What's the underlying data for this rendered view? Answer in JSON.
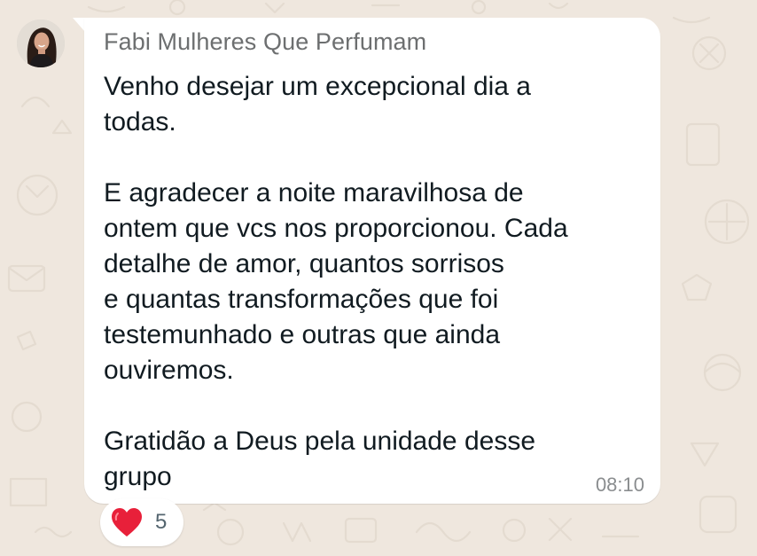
{
  "message": {
    "sender": "Fabi Mulheres Que Perfumam",
    "paragraphs": [
      [
        "Venho desejar um excepcional dia a",
        "todas."
      ],
      [
        "E agradecer a noite maravilhosa de",
        "ontem que vcs nos proporcionou. Cada",
        "detalhe de amor, quantos sorrisos",
        "e quantas transformações que foi",
        "testemunhado e outras que ainda",
        "ouviremos."
      ],
      [
        "Gratidão a Deus pela unidade desse",
        "grupo"
      ]
    ],
    "time": "08:10"
  },
  "reaction": {
    "icon": "heart-icon",
    "count": "5"
  },
  "colors": {
    "wallpaper": "#efe7de",
    "bubble": "#ffffff",
    "sender": "#6d6f70",
    "text": "#111b21",
    "time": "#8a8d8f",
    "heart": "#e8203a"
  }
}
